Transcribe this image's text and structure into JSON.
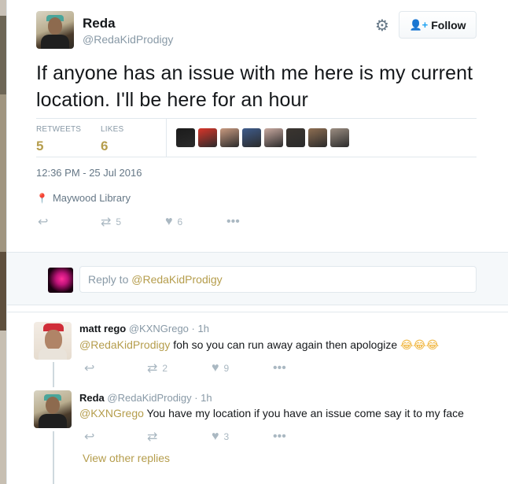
{
  "tweet": {
    "author_name": "Reda",
    "author_handle": "@RedaKidProdigy",
    "follow_label": "Follow",
    "text": "If anyone has an issue with me here is my current location. I'll be here for an hour",
    "retweets_label": "RETWEETS",
    "retweets_count": "5",
    "likes_label": "LIKES",
    "likes_count": "6",
    "timestamp": "12:36 PM - 25 Jul 2016",
    "place": "Maywood Library",
    "actions": {
      "retweets": "5",
      "likes": "6"
    },
    "liker_colors": [
      "#1b1b1b",
      "#d8352a",
      "#c89a80",
      "#3f5c8c",
      "#c8a9a0",
      "#3b3530",
      "#8e6e52",
      "#9c8e82"
    ]
  },
  "reply_box": {
    "prefix": "Reply to ",
    "mention": "@RedaKidProdigy"
  },
  "replies": [
    {
      "name": "matt rego",
      "handle": "@KXNGrego",
      "time": "· 1h",
      "mention": "@RedaKidProdigy",
      "text": " foh so you can run away again then apologize ",
      "emoji": "😂😂😂",
      "retweets": "2",
      "likes": "9"
    },
    {
      "name": "Reda",
      "handle": "@RedaKidProdigy",
      "time": "· 1h",
      "mention": "@KXNGrego",
      "text": " You have my location if you have an issue come say it to my face",
      "retweets": "",
      "likes": "3"
    }
  ],
  "view_other_replies": "View other replies",
  "icons": {
    "gear": "gear-icon",
    "follow": "add-user-icon",
    "reply": "reply-icon",
    "retweet": "retweet-icon",
    "like": "heart-icon",
    "more": "more-dots-icon",
    "place": "location-pin-icon"
  },
  "colors": {
    "accent": "#b59d4c",
    "muted": "#8899a6",
    "follow_icon": "#1da1f2"
  }
}
